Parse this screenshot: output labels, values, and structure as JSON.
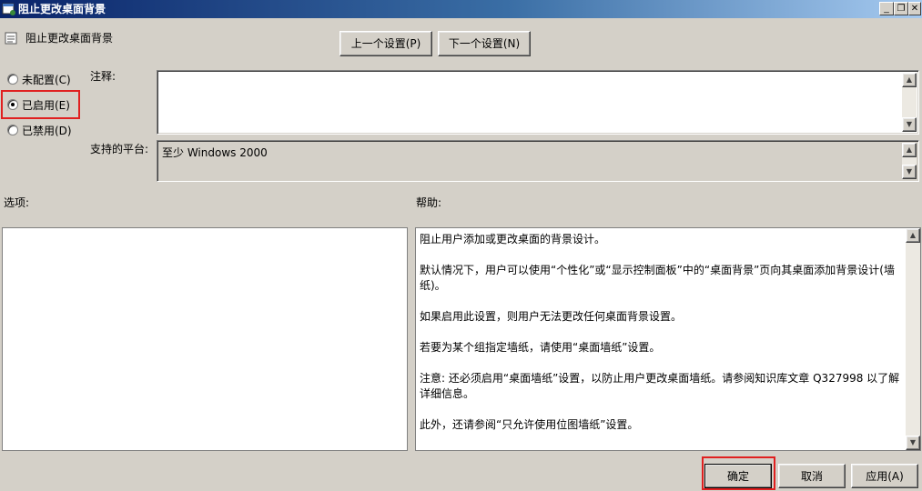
{
  "window": {
    "title": "阻止更改桌面背景",
    "icon": "policy-window-icon",
    "minimize_glyph": "_",
    "restore_glyph": "❐",
    "close_glyph": "✕"
  },
  "header": {
    "setting_title": "阻止更改桌面背景",
    "prev_button": "上一个设置(P)",
    "next_button": "下一个设置(N)"
  },
  "state": {
    "options": [
      {
        "label": "未配置(C)",
        "selected": false
      },
      {
        "label": "已启用(E)",
        "selected": true
      },
      {
        "label": "已禁用(D)",
        "selected": false
      }
    ]
  },
  "comment": {
    "label": "注释:",
    "value": ""
  },
  "platform": {
    "label": "支持的平台:",
    "value": "至少 Windows 2000"
  },
  "options_section": {
    "label": "选项:"
  },
  "help": {
    "label": "帮助:",
    "paragraphs": [
      "阻止用户添加或更改桌面的背景设计。",
      "默认情况下，用户可以使用“个性化”或“显示控制面板”中的“桌面背景”页向其桌面添加背景设计(墙纸)。",
      "如果启用此设置，则用户无法更改任何桌面背景设置。",
      "若要为某个组指定墙纸，请使用“桌面墙纸”设置。",
      "注意: 还必须启用“桌面墙纸”设置，以防止用户更改桌面墙纸。请参阅知识库文章 Q327998 以了解详细信息。",
      "此外，还请参阅“只允许使用位图墙纸”设置。"
    ]
  },
  "footer": {
    "ok_button": "确定",
    "cancel_button": "取消",
    "apply_button": "应用(A)"
  },
  "colors": {
    "highlight": "#e02020",
    "dialog_bg": "#d4d0c8",
    "titlebar": "#0a246a"
  }
}
